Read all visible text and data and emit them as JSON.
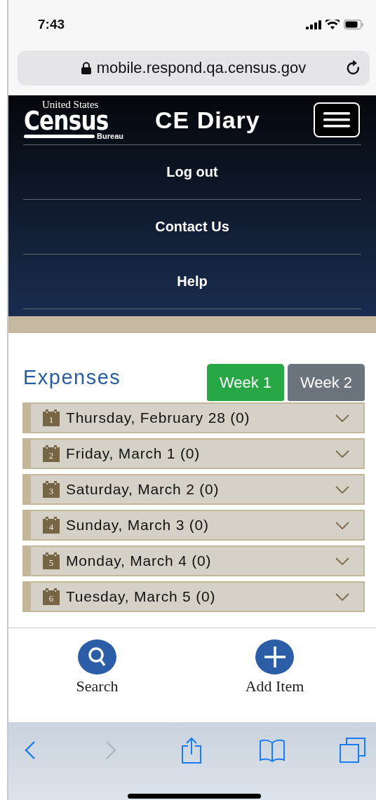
{
  "status_bar": {
    "time": "7:43"
  },
  "url_bar": {
    "url": "mobile.respond.qa.census.gov"
  },
  "header": {
    "logo": {
      "top": "United States",
      "main": "Census",
      "bottom": "Bureau"
    },
    "title": "CE Diary",
    "menu": [
      "Log out",
      "Contact Us",
      "Help"
    ]
  },
  "expenses": {
    "heading": "Expenses",
    "tabs": [
      {
        "label": "Week 1",
        "selected": true
      },
      {
        "label": "Week 2",
        "selected": false
      }
    ],
    "days": [
      {
        "icon_number": "1",
        "label": "Thursday, February 28 (0)",
        "expanded": false
      },
      {
        "icon_number": "2",
        "label": "Friday, March 1 (0)",
        "expanded": false
      },
      {
        "icon_number": "3",
        "label": "Saturday, March 2 (0)",
        "expanded": false
      },
      {
        "icon_number": "4",
        "label": "Sunday, March 3 (0)",
        "expanded": false
      },
      {
        "icon_number": "5",
        "label": "Monday, March 4 (0)",
        "expanded": false
      },
      {
        "icon_number": "6",
        "label": "Tuesday, March 5 (0)",
        "expanded": false
      }
    ]
  },
  "actions": [
    {
      "kind": "search",
      "label": "Search"
    },
    {
      "kind": "add",
      "label": "Add Item"
    }
  ]
}
